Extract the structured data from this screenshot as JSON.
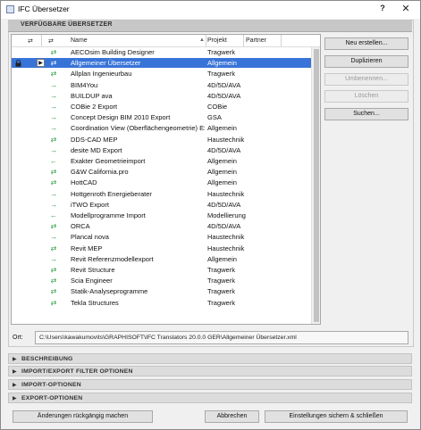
{
  "window": {
    "title": "IFC Übersetzer",
    "help_glyph": "?",
    "close_glyph": "✕"
  },
  "section": {
    "title": "VERFÜGBARE ÜBERSETZER"
  },
  "list": {
    "columns": {
      "name": "Name",
      "project": "Projekt",
      "partner": "Partner",
      "sort_glyph": "▲"
    },
    "rows": [
      {
        "dir": "⇄",
        "name": "AECOsim Building Designer",
        "project": "Tragwerk",
        "selected": false
      },
      {
        "dir": "⇄",
        "name": "Allgemeiner Übersetzer",
        "project": "Allgemein",
        "selected": true
      },
      {
        "dir": "⇄",
        "name": "Allplan Ingenieurbau",
        "project": "Tragwerk",
        "selected": false
      },
      {
        "dir": "→",
        "name": "BIM4You",
        "project": "4D/5D/AVA",
        "selected": false
      },
      {
        "dir": "→",
        "name": "BUILDUP ava",
        "project": "4D/5D/AVA",
        "selected": false
      },
      {
        "dir": "→",
        "name": "COBie 2 Export",
        "project": "COBie",
        "selected": false
      },
      {
        "dir": "→",
        "name": "Concept Design BIM 2010 Export",
        "project": "GSA",
        "selected": false
      },
      {
        "dir": "→",
        "name": "Coordination View (Oberflächengeometrie) Ex",
        "project": "Allgemein",
        "selected": false
      },
      {
        "dir": "⇄",
        "name": "DDS-CAD MEP",
        "project": "Haustechnik",
        "selected": false
      },
      {
        "dir": "→",
        "name": "desite MD Export",
        "project": "4D/5D/AVA",
        "selected": false
      },
      {
        "dir": "←",
        "name": "Exakter Geometrieimport",
        "project": "Allgemein",
        "selected": false
      },
      {
        "dir": "⇄",
        "name": "G&W California.pro",
        "project": "Allgemein",
        "selected": false
      },
      {
        "dir": "⇄",
        "name": "HottCAD",
        "project": "Allgemein",
        "selected": false
      },
      {
        "dir": "→",
        "name": "Hottgenroth Energieberater",
        "project": "Haustechnik",
        "selected": false
      },
      {
        "dir": "→",
        "name": "iTWO Export",
        "project": "4D/5D/AVA",
        "selected": false
      },
      {
        "dir": "←",
        "name": "Modellprogramme Import",
        "project": "Modellierung",
        "selected": false
      },
      {
        "dir": "⇄",
        "name": "ORCA",
        "project": "4D/5D/AVA",
        "selected": false
      },
      {
        "dir": "→",
        "name": "Plancal nova",
        "project": "Haustechnik",
        "selected": false
      },
      {
        "dir": "⇄",
        "name": "Revit MEP",
        "project": "Haustechnik",
        "selected": false
      },
      {
        "dir": "→",
        "name": "Revit Referenzmodellexport",
        "project": "Allgemein",
        "selected": false
      },
      {
        "dir": "⇄",
        "name": "Revit Structure",
        "project": "Tragwerk",
        "selected": false
      },
      {
        "dir": "⇄",
        "name": "Scia Engineer",
        "project": "Tragwerk",
        "selected": false
      },
      {
        "dir": "⇄",
        "name": "Statik-Analyseprogramme",
        "project": "Tragwerk",
        "selected": false
      },
      {
        "dir": "⇄",
        "name": "Tekla Structures",
        "project": "Tragwerk",
        "selected": false
      }
    ],
    "selected_row_play_glyph": "▶",
    "header_icons": [
      "⇄",
      "⇄"
    ]
  },
  "buttons": {
    "new": "Neu erstellen...",
    "duplicate": "Duplizieren",
    "rename": "Umbenennen...",
    "delete": "Löschen",
    "search": "Suchen...",
    "undo": "Änderungen rückgängig machen",
    "cancel": "Abbrechen",
    "save_close": "Einstellungen sichern & schließen"
  },
  "location": {
    "label": "Ort:",
    "path": "C:\\Users\\kawakumovits\\GRAPHISOFT\\IFC Translators 20.0.0 GER\\Allgemeiner Übersetzer.xml"
  },
  "collapsibles": [
    {
      "label": "BESCHREIBUNG"
    },
    {
      "label": "IMPORT/EXPORT FILTER OPTIONEN"
    },
    {
      "label": "IMPORT-OPTIONEN"
    },
    {
      "label": "EXPORT-OPTIONEN"
    }
  ],
  "colors": {
    "selection": "#3874d8",
    "arrow_green": "#2c9b3f"
  }
}
